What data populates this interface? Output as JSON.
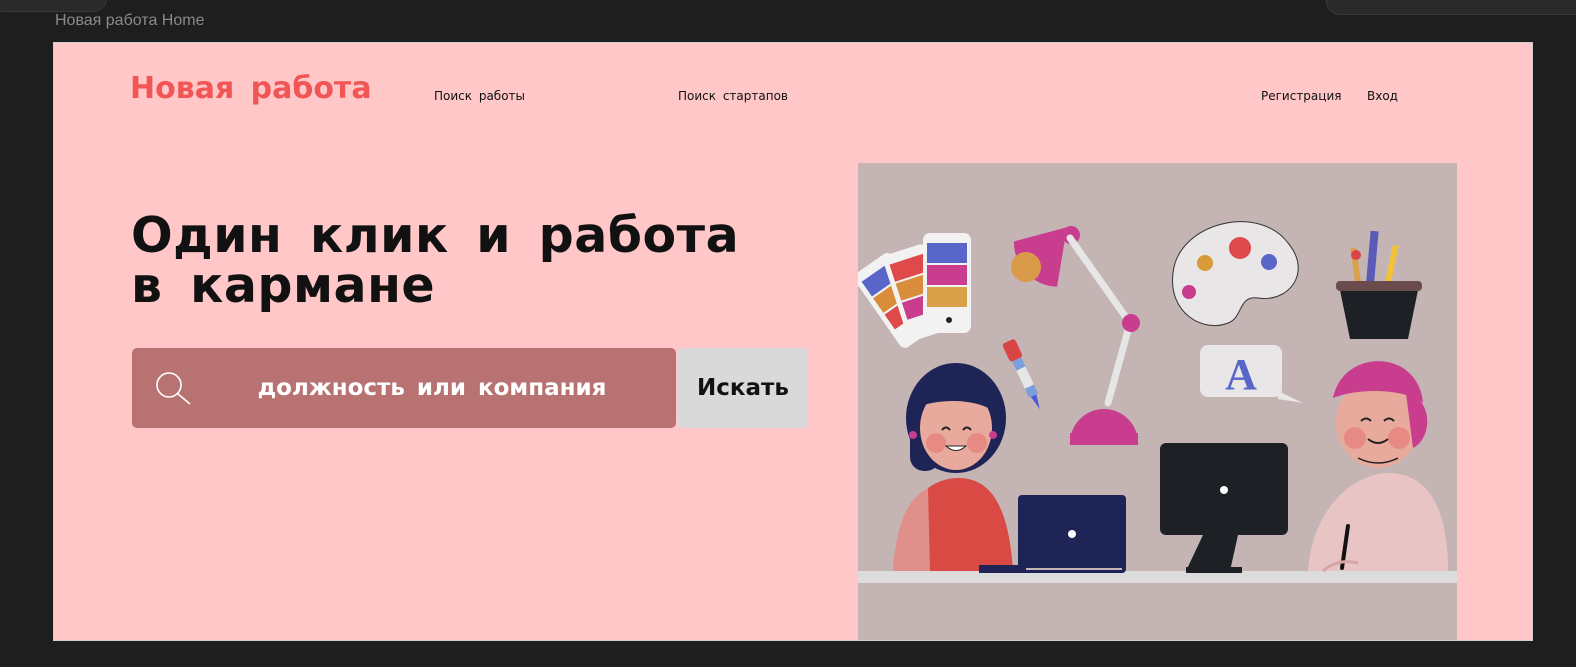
{
  "frame": {
    "label": "Новая работа Home"
  },
  "header": {
    "logo": "Новая работа",
    "nav": {
      "jobs": "Поиск работы",
      "startups": "Поиск стартапов",
      "register": "Регистрация",
      "login": "Вход"
    }
  },
  "hero": {
    "headline_line1": "Один клик и работа",
    "headline_line2": "в кармане",
    "search": {
      "placeholder": "должность или компания",
      "value": "",
      "icon": "search-icon",
      "button_label": "Искать"
    },
    "illustration": {
      "letter_card": "A"
    }
  },
  "colors": {
    "page_background": "#ffc7c7",
    "brand": "#f25555",
    "search_box": "#b87272",
    "search_button": "#d9d9d9",
    "illustration_background": "#c4b5b4",
    "app_background": "#1e1e1e"
  }
}
